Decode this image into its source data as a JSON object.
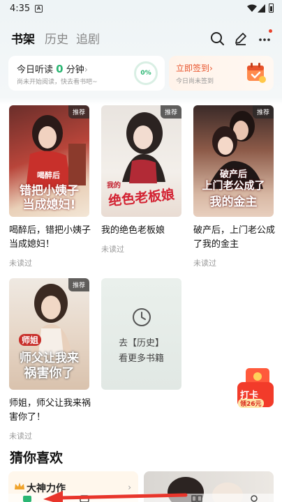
{
  "status_bar": {
    "time": "4:35",
    "badge": "A"
  },
  "nav": {
    "tabs": [
      {
        "label": "书架",
        "active": true
      },
      {
        "label": "历史",
        "active": false
      },
      {
        "label": "追剧",
        "active": false
      }
    ],
    "icons": [
      "search-icon",
      "edit-icon",
      "more-icon"
    ]
  },
  "listen": {
    "prefix": "今日听读 ",
    "minutes": "0",
    "suffix": " 分钟",
    "chevron": "›",
    "sub": "尚未开始阅读，快去看书吧~",
    "progress": "0%"
  },
  "signin": {
    "title": "立即签到›",
    "sub": "今日尚未签到"
  },
  "books": [
    {
      "title": "喝醉后，错把小姨子当成媳妇！",
      "status": "未读过",
      "tag": "推荐",
      "cover_line1": "喝醉后",
      "cover_line2": "错把小姨子",
      "cover_line3": "当成媳妇!"
    },
    {
      "title": "我的绝色老板娘",
      "status": "未读过",
      "tag": "推荐",
      "cover_line1": "我的",
      "cover_line2": "绝色老板娘"
    },
    {
      "title": "破产后，上门老公成了我的金主",
      "status": "未读过",
      "tag": "推荐",
      "cover_line1": "破产后",
      "cover_line2": "上门老公成了",
      "cover_line3": "我的金主"
    },
    {
      "title": "师姐，师父让我来祸害你了！",
      "status": "未读过",
      "tag": "推荐",
      "cover_line1": "师姐",
      "cover_line2": "师父让我来",
      "cover_line3": "祸害你了"
    }
  ],
  "history_card": {
    "line1": "去【历史】",
    "line2": "看更多书籍"
  },
  "checkin_float": {
    "label": "打卡",
    "reward": "领26元"
  },
  "guess": {
    "title": "猜你喜欢",
    "card1_label": "大神力作",
    "card1_chevron": "›"
  },
  "colors": {
    "accent_green": "#2bb673",
    "accent_orange": "#e8532b",
    "dot_red": "#e8412b"
  }
}
